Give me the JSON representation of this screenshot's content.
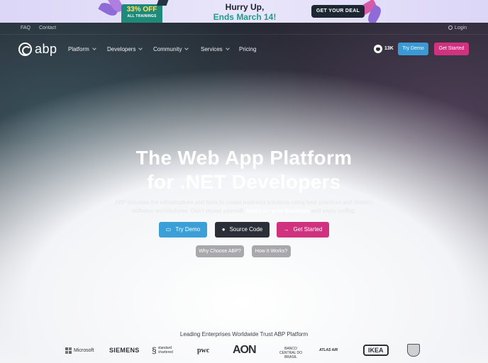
{
  "promo": {
    "badge_percent": "33% OFF",
    "badge_sub": "ALL TRAININGS",
    "headline": "Hurry Up,",
    "deadline": "Ends March 14!",
    "cta": "GET YOUR DEAL"
  },
  "utility": {
    "faq": "FAQ",
    "contact": "Contact",
    "login": "Login"
  },
  "nav": {
    "logo": "abp",
    "items": [
      "Platform",
      "Developers",
      "Community",
      "Services",
      "Pricing"
    ],
    "github_count": "13K",
    "try_demo": "Try Demo",
    "get_started": "Get Started"
  },
  "hero": {
    "title_line1": "The Web App Platform",
    "title_line2": "for .NET Developers",
    "lead_part1": "ABP provides the infrastructure and tools to create business solutions using best practices and modern software architectures. Don't repeat yourself,",
    "lead_bold": "focus on your business",
    "lead_part2": "and enjoy coding.",
    "cta_demo": "Try Demo",
    "cta_source": "Source Code",
    "cta_start": "Get Started",
    "why": "Why Choose ABP?",
    "how": "How It Works?"
  },
  "trust": {
    "title": "Leading Enterprises Worldwide Trust ABP Platform",
    "logos": {
      "microsoft": "Microsoft",
      "siemens": "SIEMENS",
      "standard_chartered": "standard chartered",
      "pwc": "pwc",
      "aon": "AON",
      "banco": "BANCO CENTRAL DO BRASIL",
      "atlas": "ATLAS AIR",
      "ikea": "IKEA"
    }
  },
  "colors": {
    "accent_blue": "#3a9ad6",
    "accent_pink": "#d0327f",
    "promo_teal": "#1e9c8a"
  }
}
